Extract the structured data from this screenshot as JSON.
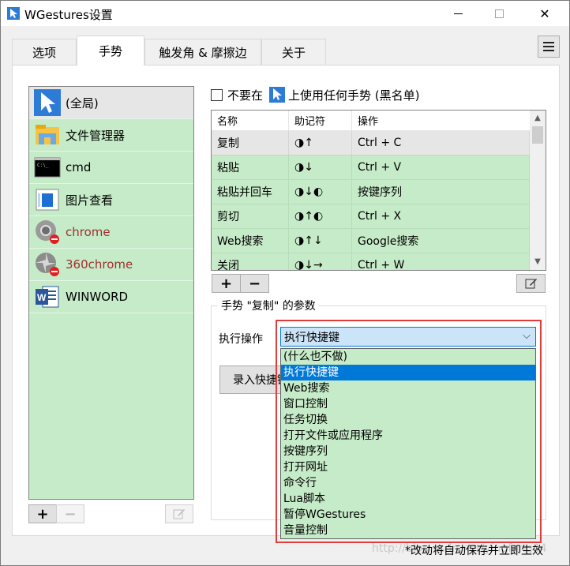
{
  "window": {
    "title": "WGestures设置"
  },
  "tabs": [
    {
      "label": "选项",
      "active": false
    },
    {
      "label": "手势",
      "active": true
    },
    {
      "label": "触发角 & 摩擦边",
      "active": false
    },
    {
      "label": "关于",
      "active": false
    }
  ],
  "apps": [
    {
      "label": "(全局)",
      "icon": "cursor-icon",
      "selected": true
    },
    {
      "label": "文件管理器",
      "icon": "folder-icon"
    },
    {
      "label": "cmd",
      "icon": "console-icon"
    },
    {
      "label": "图片查看",
      "icon": "image-viewer-icon"
    },
    {
      "label": "chrome",
      "icon": "chrome-icon",
      "blacklisted": true
    },
    {
      "label": "360chrome",
      "icon": "360chrome-icon",
      "blacklisted": true
    },
    {
      "label": "WINWORD",
      "icon": "word-icon"
    }
  ],
  "app_buttons": {
    "add": "+",
    "remove": "−"
  },
  "blacklist": {
    "prefix": "不要在",
    "suffix": "上使用任何手势 (黑名单)",
    "checked": false
  },
  "gesture_table": {
    "headers": [
      "名称",
      "助记符",
      "操作"
    ],
    "rows": [
      {
        "name": "复制",
        "mnemonic": "◑↑",
        "action": "Ctrl + C",
        "selected": true
      },
      {
        "name": "粘贴",
        "mnemonic": "◑↓",
        "action": "Ctrl + V"
      },
      {
        "name": "粘贴并回车",
        "mnemonic": "◑↓◐",
        "action": "按键序列"
      },
      {
        "name": "剪切",
        "mnemonic": "◑↑◐",
        "action": "Ctrl + X"
      },
      {
        "name": "Web搜索",
        "mnemonic": "◑↑↓",
        "action": "Google搜索"
      },
      {
        "name": "关闭",
        "mnemonic": "◑↓→",
        "action": "Ctrl + W"
      }
    ]
  },
  "gesture_buttons": {
    "add": "+",
    "remove": "−"
  },
  "params": {
    "title": "手势 \"复制\" 的参数",
    "action_label": "执行操作",
    "selected_action": "执行快捷键",
    "record_button": "录入快捷键"
  },
  "dropdown_options": [
    "(什么也不做)",
    "执行快捷键",
    "Web搜索",
    "窗口控制",
    "任务切换",
    "打开文件或应用程序",
    "按键序列",
    "打开网址",
    "命令行",
    "Lua脚本",
    "暂停WGestures",
    "音量控制"
  ],
  "dropdown_selected_index": 1,
  "footer_note": "*改动将自动保存并立即生效",
  "watermark": "http://blog.csdn.net/yingfang44",
  "colors": {
    "list_bg": "#c6ebc8",
    "highlight": "#e33a3a",
    "accent": "#0078d7",
    "blacklisted_text": "#a03030"
  }
}
